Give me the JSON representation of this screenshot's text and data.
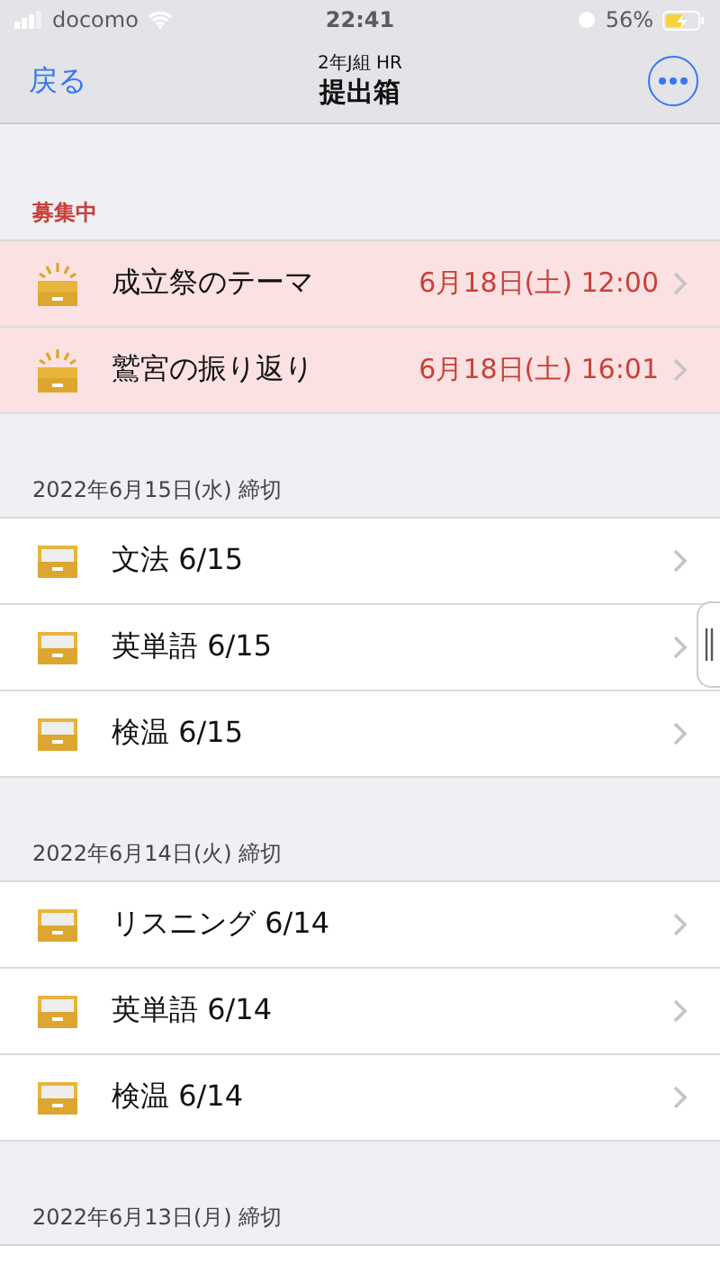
{
  "status_bar": {
    "carrier": "docomo",
    "time": "22:41",
    "battery": "56%"
  },
  "nav": {
    "back": "戻る",
    "subtitle": "2年J組 HR",
    "title": "提出箱"
  },
  "sections": [
    {
      "kind": "open",
      "header": "募集中",
      "rows": [
        {
          "title": "成立祭のテーマ",
          "deadline": "6月18日(土) 12:00"
        },
        {
          "title": "鷲宮の振り返り",
          "deadline": "6月18日(土) 16:01"
        }
      ]
    },
    {
      "kind": "closed",
      "header": "2022年6月15日(水) 締切",
      "rows": [
        {
          "title": "文法 6/15"
        },
        {
          "title": "英単語 6/15"
        },
        {
          "title": "検温 6/15"
        }
      ]
    },
    {
      "kind": "closed",
      "header": "2022年6月14日(火) 締切",
      "rows": [
        {
          "title": "リスニング 6/14"
        },
        {
          "title": "英単語 6/14"
        },
        {
          "title": "検温 6/14"
        }
      ]
    },
    {
      "kind": "closed",
      "header": "2022年6月13日(月) 締切"
    }
  ]
}
